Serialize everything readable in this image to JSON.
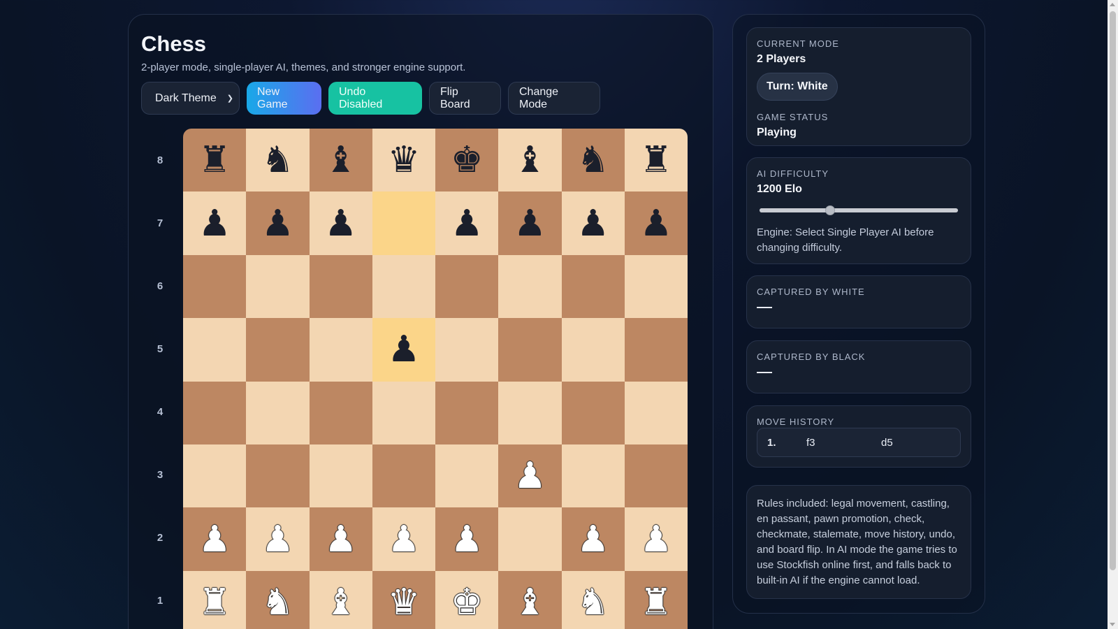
{
  "header": {
    "title": "Chess",
    "subtitle": "2-player mode, single-player AI, themes, and stronger engine support."
  },
  "toolbar": {
    "theme_select": "Dark Theme",
    "new_game": "New Game",
    "undo": "Undo Disabled",
    "flip": "Flip Board",
    "change_mode": "Change Mode"
  },
  "board": {
    "ranks": [
      "8",
      "7",
      "6",
      "5",
      "4",
      "3",
      "2",
      "1"
    ],
    "highlighted": [
      "d7",
      "d5"
    ],
    "pieces": {
      "a8": "bR",
      "b8": "bN",
      "c8": "bB",
      "d8": "bQ",
      "e8": "bK",
      "f8": "bB",
      "g8": "bN",
      "h8": "bR",
      "a7": "bP",
      "b7": "bP",
      "c7": "bP",
      "e7": "bP",
      "f7": "bP",
      "g7": "bP",
      "h7": "bP",
      "d5": "bP",
      "f3": "wP",
      "a2": "wP",
      "b2": "wP",
      "c2": "wP",
      "d2": "wP",
      "e2": "wP",
      "g2": "wP",
      "h2": "wP",
      "a1": "wR",
      "b1": "wN",
      "c1": "wB",
      "d1": "wQ",
      "e1": "wK",
      "f1": "wB",
      "g1": "wN",
      "h1": "wR"
    },
    "colors": {
      "light": "#f3d6b2",
      "dark": "#bd8762",
      "highlight": "#fbd589"
    }
  },
  "status": {
    "mode_label": "CURRENT MODE",
    "mode_value": "2 Players",
    "turn": "Turn: White",
    "game_status_label": "GAME STATUS",
    "game_status_value": "Playing"
  },
  "ai": {
    "label": "AI DIFFICULTY",
    "value": "1200 Elo",
    "slider_fraction": 0.36,
    "engine_note": "Engine: Select Single Player AI before changing difficulty."
  },
  "captured_white": {
    "label": "CAPTURED BY WHITE",
    "value": "—"
  },
  "captured_black": {
    "label": "CAPTURED BY BLACK",
    "value": "—"
  },
  "history": {
    "label": "MOVE HISTORY",
    "moves": [
      {
        "num": "1.",
        "white": "f3",
        "black": "d5"
      }
    ]
  },
  "rules": "Rules included: legal movement, castling, en passant, pawn promotion, check, checkmate, stalemate, move history, undo, and board flip. In AI mode the game tries to use Stockfish online first, and falls back to built-in AI if the engine cannot load."
}
